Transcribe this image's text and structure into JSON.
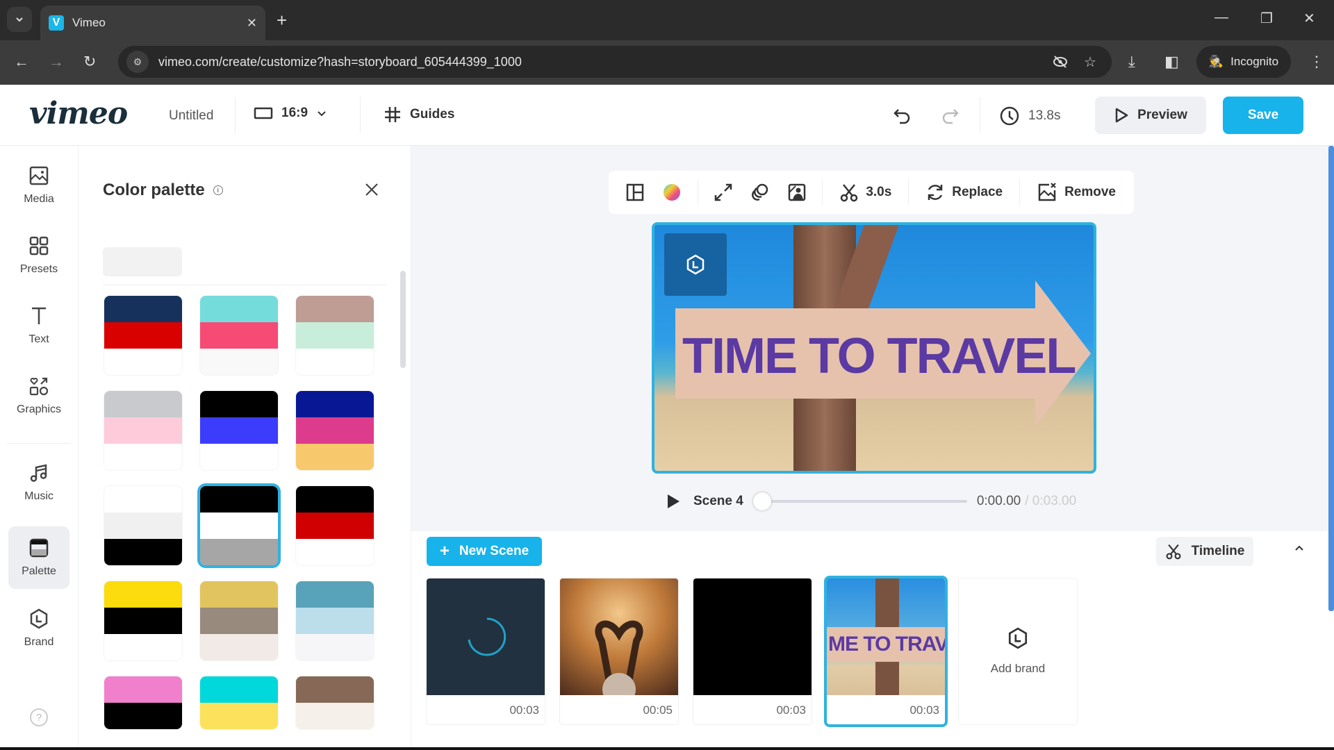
{
  "browser": {
    "tab_title": "Vimeo",
    "tab_favicon": "V",
    "url": "vimeo.com/create/customize?hash=storyboard_605444399_1000",
    "incognito_label": "Incognito",
    "icons": [
      "tab-search-icon",
      "back-icon",
      "forward-icon",
      "reload-icon",
      "site-info-icon",
      "eye-off-icon",
      "star-icon",
      "download-icon",
      "side-panel-icon",
      "incognito-icon",
      "kebab-menu-icon",
      "minimize-icon",
      "restore-icon",
      "close-icon"
    ]
  },
  "header": {
    "logo": "vimeo",
    "project_title": "Untitled",
    "aspect_ratio": "16:9",
    "guides_label": "Guides",
    "duration": "13.8s",
    "preview_label": "Preview",
    "save_label": "Save"
  },
  "sidebar": {
    "items": [
      {
        "label": "Media",
        "icon": "image-icon"
      },
      {
        "label": "Presets",
        "icon": "grid-icon"
      },
      {
        "label": "Text",
        "icon": "text-icon"
      },
      {
        "label": "Graphics",
        "icon": "shapes-icon"
      },
      {
        "label": "Music",
        "icon": "music-icon"
      },
      {
        "label": "Palette",
        "icon": "palette-icon",
        "active": true
      },
      {
        "label": "Brand",
        "icon": "brand-icon"
      }
    ],
    "help_label": "?"
  },
  "palette_panel": {
    "title": "Color palette",
    "selected_index": 7,
    "palettes": [
      [
        "#16325c",
        "#d90000",
        "#ffffff"
      ],
      [
        "#74dcda",
        "#f64b74",
        "#f9f9f9"
      ],
      [
        "#bf9c94",
        "#c8eedb",
        "#ffffff"
      ],
      [
        "#c8cacd",
        "#fecbdb",
        "#ffffff"
      ],
      [
        "#000000",
        "#3c3cfc",
        "#ffffff"
      ],
      [
        "#081894",
        "#dd3c8c",
        "#f8c86c"
      ],
      [
        "#ffffff",
        "#f0f0f0",
        "#000000"
      ],
      [
        "#000000",
        "#ffffff",
        "#a6a6a6"
      ],
      [
        "#000000",
        "#d00000",
        "#ffffff"
      ],
      [
        "#fcdc0c",
        "#000000",
        "#ffffff"
      ],
      [
        "#e2c45e",
        "#988a7c",
        "#f2eae6"
      ],
      [
        "#58a2ba",
        "#bcdeea",
        "#f6f6f8"
      ],
      [
        "#f080cc",
        "#000000"
      ],
      [
        "#00d8dc",
        "#fce25c"
      ],
      [
        "#866856",
        "#f6f0ea"
      ]
    ]
  },
  "canvas_toolbar": {
    "items": [
      {
        "icon": "layout-icon"
      },
      {
        "icon": "color-wheel-icon"
      },
      {
        "icon": "expand-icon"
      },
      {
        "icon": "overlay-icon"
      },
      {
        "icon": "background-remove-icon"
      }
    ],
    "trim_label": "3.0s",
    "replace_label": "Replace",
    "remove_label": "Remove"
  },
  "stage": {
    "text": "TIME TO TRAVEL",
    "brand_icon": "L"
  },
  "player": {
    "scene_label": "Scene 4",
    "current_time": "0:00.00",
    "total_time": "/ 0:03.00",
    "progress": 0
  },
  "scenes": {
    "new_scene_label": "New Scene",
    "timeline_label": "Timeline",
    "items": [
      {
        "duration": "00:03",
        "kind": "loading"
      },
      {
        "duration": "00:05",
        "kind": "concert"
      },
      {
        "duration": "00:03",
        "kind": "black"
      },
      {
        "duration": "00:03",
        "kind": "travel",
        "thumb_text": "ME TO TRAVEL",
        "selected": true
      }
    ],
    "add_brand_label": "Add brand",
    "add_brand_icon": "L"
  },
  "colors": {
    "accent": "#17b3ea",
    "selection": "#2fb2e0",
    "brand_tile": "#1762a0"
  }
}
